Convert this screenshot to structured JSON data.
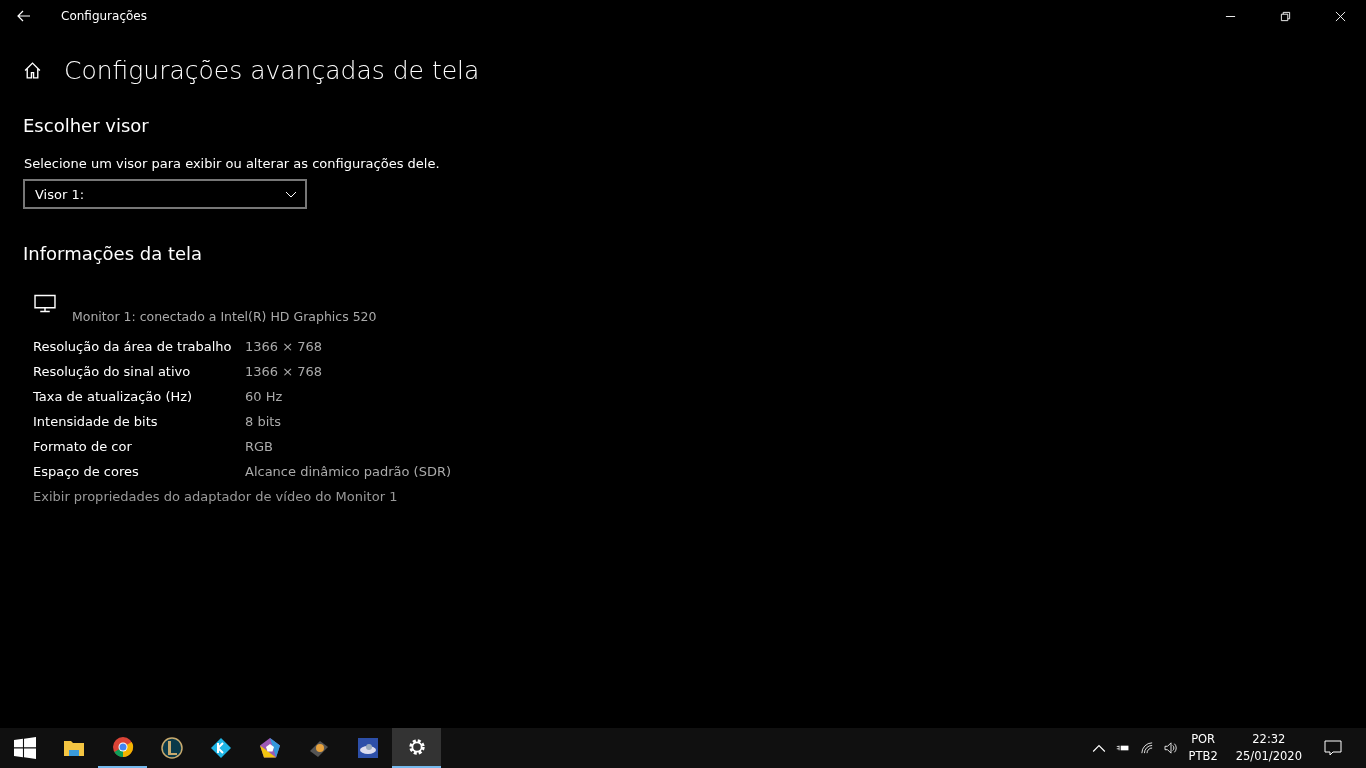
{
  "window": {
    "title": "Configurações"
  },
  "page": {
    "title": "Configurações avançadas de tela"
  },
  "choose_display": {
    "heading": "Escolher visor",
    "description": "Selecione um visor para exibir ou alterar as configurações dele.",
    "dropdown": {
      "value": "Visor 1:"
    }
  },
  "display_info": {
    "heading": "Informações da tela",
    "monitor": "Monitor 1: conectado a Intel(R) HD Graphics 520",
    "rows": [
      {
        "label": "Resolução da área de trabalho",
        "value": "1366 × 768"
      },
      {
        "label": "Resolução do sinal ativo",
        "value": "1366 × 768"
      },
      {
        "label": "Taxa de atualização (Hz)",
        "value": "60 Hz"
      },
      {
        "label": "Intensidade de bits",
        "value": "8 bits"
      },
      {
        "label": "Formato de cor",
        "value": "RGB"
      },
      {
        "label": "Espaço de cores",
        "value": "Alcance dinâmico padrão (SDR)"
      }
    ],
    "link": "Exibir propriedades do adaptador de vídeo do Monitor 1"
  },
  "taskbar": {
    "apps": [
      {
        "kind": "folder",
        "running": false,
        "selected": false
      },
      {
        "kind": "browser",
        "running": true,
        "selected": false
      },
      {
        "kind": "game",
        "running": false,
        "selected": false
      },
      {
        "kind": "media",
        "running": false,
        "selected": false
      },
      {
        "kind": "pentagon",
        "running": false,
        "selected": false
      },
      {
        "kind": "disk",
        "running": false,
        "selected": false
      },
      {
        "kind": "drive",
        "running": false,
        "selected": false
      },
      {
        "kind": "settings",
        "running": true,
        "selected": true
      }
    ],
    "language": "POR",
    "layout": "PTB2",
    "time": "22:32",
    "date": "25/01/2020"
  }
}
